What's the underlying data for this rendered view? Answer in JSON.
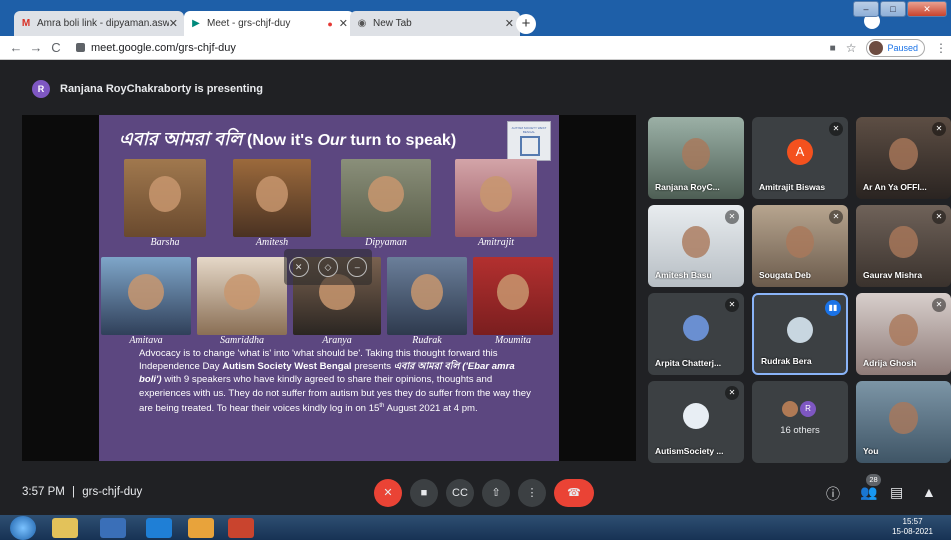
{
  "browser": {
    "tabs": [
      {
        "label": "Amra boli link - dipyaman.aswb",
        "icon": "gmail-icon"
      },
      {
        "label": "Meet - grs-chjf-duy",
        "icon": "meet-icon"
      },
      {
        "label": "New Tab",
        "icon": "chrome-icon"
      }
    ],
    "url": "meet.google.com/grs-chjf-duy",
    "profile_status": "Paused"
  },
  "meet": {
    "presenter_initial": "R",
    "presenting_text": "Ranjana RoyChakraborty is presenting",
    "slide": {
      "title_bengali": "এবার আমরা বলি",
      "title_paren_open": "(Now it's ",
      "title_our": "Our",
      "title_paren_close": " turn to speak)",
      "logo_text": "AUTISM SOCIETY WEST BENGAL",
      "speakers": [
        "Barsha",
        "Amitesh",
        "Dipyaman",
        "Amitrajit",
        "Amitava",
        "Samriddha",
        "Aranya",
        "Rudrak",
        "Moumita"
      ],
      "body_1": "Advocacy is to change 'what is' into 'what should be'. Taking this thought forward this Independence Day ",
      "body_org": "Autism Society West Bengal",
      "body_2": " presents ",
      "body_bengali": "এবার আমরা বলি",
      "body_translit": "('Ebar amra boli')",
      "body_3": " with 9 speakers who have kindly agreed to share their opinions, thoughts and experiences with us. They do not suffer from autism but yes they do suffer from the way they are being treated. To hear their voices kindly log in on ",
      "body_date_num": "15",
      "body_date_sup": "th",
      "body_date_rest": " August 2021 at 4 pm."
    },
    "participants": [
      {
        "name": "Ranjana RoyC..."
      },
      {
        "name": "Amitrajit Biswas",
        "initial": "A"
      },
      {
        "name": "Ar An Ya OFFI..."
      },
      {
        "name": "Amitesh Basu"
      },
      {
        "name": "Sougata Deb"
      },
      {
        "name": "Gaurav Mishra"
      },
      {
        "name": "Arpita Chatterj..."
      },
      {
        "name": "Rudrak Bera"
      },
      {
        "name": "Adrija Ghosh"
      },
      {
        "name": "AutismSociety ..."
      },
      {
        "name": "16 others",
        "initial": "R"
      },
      {
        "name": "You"
      }
    ],
    "time": "3:57 PM",
    "separator": "|",
    "meeting_code": "grs-chjf-duy",
    "participant_count": "28"
  },
  "taskbar": {
    "time": "15:57",
    "date": "15-08-2021"
  },
  "colors": {
    "slide_bg": "#5c4780",
    "meet_bg": "#202124",
    "hangup": "#ea4335"
  }
}
